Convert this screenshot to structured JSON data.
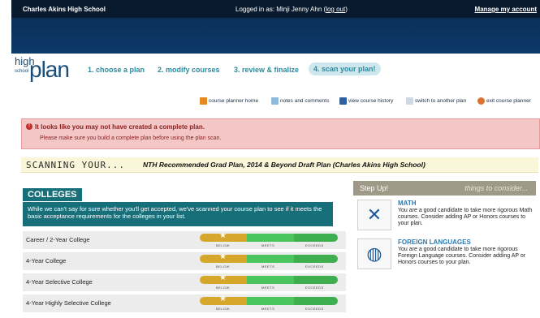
{
  "topbar": {
    "school": "Charles Akins High School",
    "login_prefix": "Logged in as: Minji Jenny Ahn (",
    "logout": "log out",
    "login_suffix": ")",
    "manage": "Manage my account"
  },
  "logo": {
    "high": "high",
    "school": "school",
    "plan": "plan"
  },
  "steps": [
    {
      "label": "1. choose a plan"
    },
    {
      "label": "2. modify courses"
    },
    {
      "label": "3. review & finalize"
    },
    {
      "label": "4. scan your plan!"
    }
  ],
  "toolbar": [
    {
      "label": "course planner home",
      "icon": "house-icon"
    },
    {
      "label": "notes and comments",
      "icon": "comment-icon"
    },
    {
      "label": "view course history",
      "icon": "history-icon"
    },
    {
      "label": "switch to another plan",
      "icon": "switch-icon"
    },
    {
      "label": "exit course planner",
      "icon": "exit-icon"
    }
  ],
  "alert": {
    "title": "It looks like you may not have created a complete plan.",
    "message": "Please make sure you build a complete plan before using the plan scan."
  },
  "scan": {
    "label": "SCANNING YOUR...",
    "plan": "NTH Recommended Grad Plan, 2014 & Beyond Draft Plan (Charles Akins High School)"
  },
  "colleges": {
    "heading": "COLLEGES",
    "description": "While we can't say for sure whether you'll get accepted, we've scanned your course plan to see if it meets the basic acceptance requirements for the colleges in your list.",
    "bar_labels": {
      "below": "BELOW",
      "meets": "MEETS",
      "exceeds": "EXCEEDS"
    },
    "rows": [
      {
        "name": "Career / 2-Year College"
      },
      {
        "name": "4-Year College"
      },
      {
        "name": "4-Year Selective College"
      },
      {
        "name": "4-Year Highly Selective College"
      }
    ]
  },
  "stepup": {
    "title": "Step Up!",
    "subtitle": "things to consider...",
    "cards": [
      {
        "title": "MATH",
        "body": "You are a good candidate to take more rigorous Math courses. Consider adding AP or Honors courses to your plan.",
        "icon": "math-tools-icon"
      },
      {
        "title": "FOREIGN LANGUAGES",
        "body": "You are a good candidate to take more rigorous Foreign Language courses. Consider adding AP or Honors courses to your plan.",
        "icon": "globe-icon"
      }
    ]
  },
  "colors": {
    "accent": "#176f7a",
    "topbar": "#0a1a2e",
    "alert_bg": "#f4c7c7",
    "step_link": "#2a8ba0"
  }
}
